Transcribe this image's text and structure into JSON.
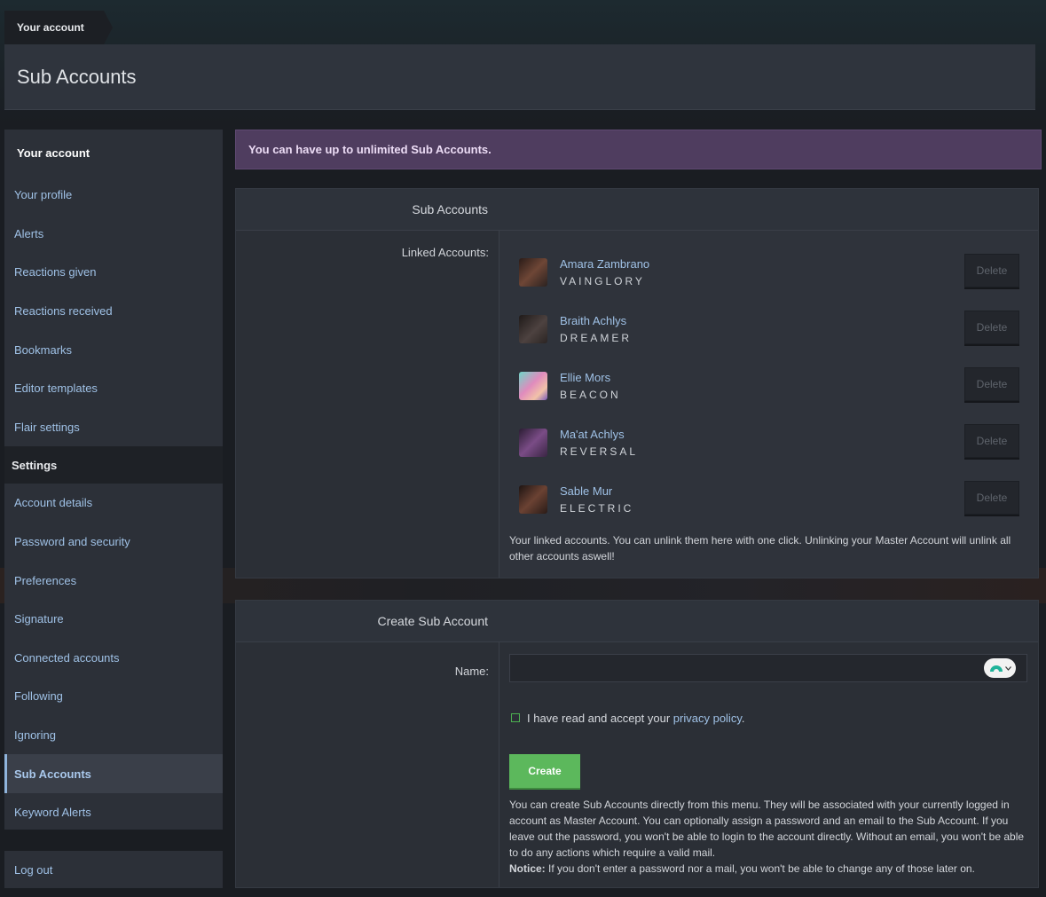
{
  "breadcrumb": {
    "label": "Your account"
  },
  "page": {
    "title": "Sub Accounts"
  },
  "sidebar": {
    "account_heading": "Your account",
    "account_items": [
      {
        "label": "Your profile"
      },
      {
        "label": "Alerts"
      },
      {
        "label": "Reactions given"
      },
      {
        "label": "Reactions received"
      },
      {
        "label": "Bookmarks"
      },
      {
        "label": "Editor templates"
      },
      {
        "label": "Flair settings"
      }
    ],
    "settings_heading": "Settings",
    "settings_items": [
      {
        "label": "Account details"
      },
      {
        "label": "Password and security"
      },
      {
        "label": "Preferences"
      },
      {
        "label": "Signature"
      },
      {
        "label": "Connected accounts"
      },
      {
        "label": "Following"
      },
      {
        "label": "Ignoring"
      },
      {
        "label": "Sub Accounts"
      },
      {
        "label": "Keyword Alerts"
      }
    ],
    "logout": "Log out"
  },
  "notice": "You can have up to unlimited Sub Accounts.",
  "sub_accounts": {
    "heading": "Sub Accounts",
    "linked_label": "Linked Accounts:",
    "delete_label": "Delete",
    "accounts": [
      {
        "name": "Amara Zambrano",
        "title": "VAINGLORY",
        "avatar_color": "#5a3a2e"
      },
      {
        "name": "Braith Achlys",
        "title": "DREAMER",
        "avatar_color": "#3a3230"
      },
      {
        "name": "Ellie Mors",
        "title": "BEACON",
        "avatar_color": "#c98ab8"
      },
      {
        "name": "Ma'at Achlys",
        "title": "REVERSAL",
        "avatar_color": "#5b3a63"
      },
      {
        "name": "Sable Mur",
        "title": "ELECTRIC",
        "avatar_color": "#4a3028"
      }
    ],
    "explanation": "Your linked accounts. You can unlink them here with one click. Unlinking your Master Account will unlink all other accounts aswell!"
  },
  "create": {
    "heading": "Create Sub Account",
    "name_label": "Name:",
    "name_value": "",
    "checkbox_text": "I have read and accept your",
    "privacy_link": "privacy policy",
    "checkbox_suffix": ".",
    "button_label": "Create",
    "explanation": "You can create Sub Accounts directly from this menu. They will be associated with your currently logged in account as Master Account. You can optionally assign a password and an email to the Sub Account. If you leave out the password, you won't be able to login to the account directly. Without an email, you won't be able to do any actions which require a valid mail.",
    "notice_label": "Notice:",
    "notice_text": "If you don't enter a password nor a mail, you won't be able to change any of those later on."
  }
}
